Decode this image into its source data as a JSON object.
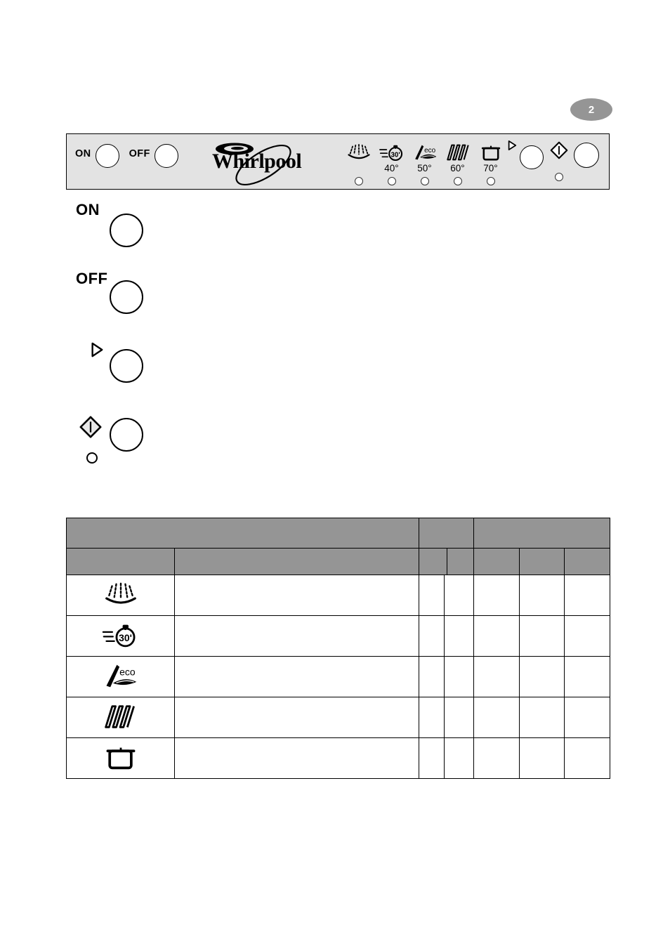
{
  "page": {
    "badge_label": "2",
    "background_color": "#ffffff"
  },
  "control_panel": {
    "name": "dishwasher-control-panel",
    "background_color": "#e3e3e3",
    "border_color": "#000000",
    "brand": "Whirlpool",
    "power": [
      {
        "label": "ON",
        "icon": "power-on-button"
      },
      {
        "label": "OFF",
        "icon": "power-off-button"
      }
    ],
    "programs": [
      {
        "icon": "prewash-spray-icon",
        "temp": "",
        "led": "indicator-light"
      },
      {
        "icon": "rapid-30-stopwatch-icon",
        "temp": "40°",
        "led": "indicator-light"
      },
      {
        "icon": "eco-leaf-icon",
        "temp": "50°",
        "led": "indicator-light"
      },
      {
        "icon": "plates-dishes-icon",
        "temp": "60°",
        "led": "indicator-light"
      },
      {
        "icon": "pots-pans-icon",
        "temp": "70°",
        "led": "indicator-light"
      }
    ],
    "program_select": {
      "icon": "play-triangle-icon",
      "button": "program-select-button"
    },
    "start": {
      "icon": "start-diamond-icon",
      "button": "start-button",
      "led": "start-indicator-light"
    }
  },
  "legend": [
    {
      "key": "on",
      "label": "ON",
      "icon": "",
      "control": "round-button",
      "has_led": false
    },
    {
      "key": "off",
      "label": "OFF",
      "icon": "",
      "control": "round-button",
      "has_led": false
    },
    {
      "key": "program",
      "label": "",
      "icon": "play-triangle-icon",
      "control": "round-button",
      "has_led": false
    },
    {
      "key": "start",
      "label": "",
      "icon": "start-diamond-icon",
      "control": "round-button",
      "has_led": true
    }
  ],
  "program_table": {
    "name": "programme-chart",
    "header_bg": "#959595",
    "header_row_1": [
      "",
      "",
      "",
      ""
    ],
    "header_row_2": [
      "",
      "",
      "",
      "",
      "",
      ""
    ],
    "rows": [
      {
        "icon": "prewash-spray-icon",
        "description": "",
        "cells": [
          "",
          "",
          "",
          "",
          ""
        ]
      },
      {
        "icon": "rapid-30-stopwatch-icon",
        "description": "",
        "cells": [
          "",
          "",
          "",
          "",
          ""
        ]
      },
      {
        "icon": "eco-leaf-icon",
        "description": "",
        "cells": [
          "",
          "",
          "",
          "",
          ""
        ]
      },
      {
        "icon": "plates-dishes-icon",
        "description": "",
        "cells": [
          "",
          "",
          "",
          "",
          ""
        ]
      },
      {
        "icon": "pots-pans-icon",
        "description": "",
        "cells": [
          "",
          "",
          "",
          "",
          ""
        ]
      }
    ]
  }
}
